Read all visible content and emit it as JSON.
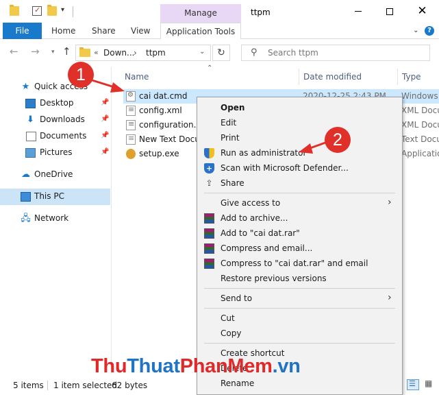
{
  "window": {
    "title": "ttpm",
    "context_tab_group": "Manage",
    "minimize_glyph": "",
    "close_glyph": "✕"
  },
  "ribbon": {
    "tabs": [
      {
        "label": "File",
        "active": true
      },
      {
        "label": "Home"
      },
      {
        "label": "Share"
      },
      {
        "label": "View"
      },
      {
        "label": "Application Tools"
      }
    ],
    "help_glyph": "?"
  },
  "address": {
    "chevron": "«",
    "path": [
      "Down...",
      "ttpm"
    ],
    "separator": "›",
    "search_placeholder": "Search ttpm"
  },
  "navpane": {
    "items": [
      {
        "label": "Quick access",
        "icon": "star-icon",
        "pinned": false
      },
      {
        "label": "Desktop",
        "icon": "desktop-icon",
        "pinned": true
      },
      {
        "label": "Downloads",
        "icon": "download-icon",
        "pinned": true
      },
      {
        "label": "Documents",
        "icon": "documents-icon",
        "pinned": true
      },
      {
        "label": "Pictures",
        "icon": "pictures-icon",
        "pinned": true
      },
      {
        "label": "OneDrive",
        "icon": "cloud-icon",
        "pinned": false
      },
      {
        "label": "This PC",
        "icon": "computer-icon",
        "pinned": false,
        "selected": true
      },
      {
        "label": "Network",
        "icon": "network-icon",
        "pinned": false
      }
    ]
  },
  "filelist": {
    "columns": [
      "Name",
      "Date modified",
      "Type"
    ],
    "rows": [
      {
        "name": "cai dat.cmd",
        "date": "2020-12-25 2:43 PM",
        "type": "Windows",
        "icon": "cmd-file-icon",
        "selected": true
      },
      {
        "name": "config.xml",
        "date": "",
        "type": "XML Docu",
        "icon": "xml-file-icon"
      },
      {
        "name": "configuration.xr",
        "date": "",
        "type": "XML Docu",
        "icon": "xml-file-icon"
      },
      {
        "name": "New Text Docur",
        "date": "",
        "type": "Text Docu",
        "icon": "text-file-icon"
      },
      {
        "name": "setup.exe",
        "date": "",
        "type": "Applicatio",
        "icon": "exe-file-icon"
      }
    ]
  },
  "context_menu": {
    "groups": [
      [
        {
          "label": "Open",
          "bold": true
        },
        {
          "label": "Edit"
        },
        {
          "label": "Print"
        },
        {
          "label": "Run as administrator",
          "icon": "uac-shield-icon"
        },
        {
          "label": "Scan with Microsoft Defender...",
          "icon": "defender-icon"
        },
        {
          "label": "Share",
          "icon": "share-icon"
        }
      ],
      [
        {
          "label": "Give access to",
          "submenu": true
        },
        {
          "label": "Add to archive...",
          "icon": "winrar-icon"
        },
        {
          "label": "Add to \"cai dat.rar\"",
          "icon": "winrar-icon"
        },
        {
          "label": "Compress and email...",
          "icon": "winrar-icon"
        },
        {
          "label": "Compress to \"cai dat.rar\" and email",
          "icon": "winrar-icon"
        },
        {
          "label": "Restore previous versions"
        }
      ],
      [
        {
          "label": "Send to",
          "submenu": true
        }
      ],
      [
        {
          "label": "Cut"
        },
        {
          "label": "Copy"
        }
      ],
      [
        {
          "label": "Create shortcut"
        },
        {
          "label": "Delete"
        },
        {
          "label": "Rename"
        }
      ]
    ]
  },
  "status": {
    "items_count": "5 items",
    "selection": "1 item selected",
    "size": "62 bytes"
  },
  "annotations": {
    "step1": "1",
    "step2": "2",
    "color": "#e0302a"
  },
  "watermark": {
    "part1": "Thu",
    "part2": "Thuat",
    "part3": "PhanMem",
    "part4": ".vn"
  }
}
